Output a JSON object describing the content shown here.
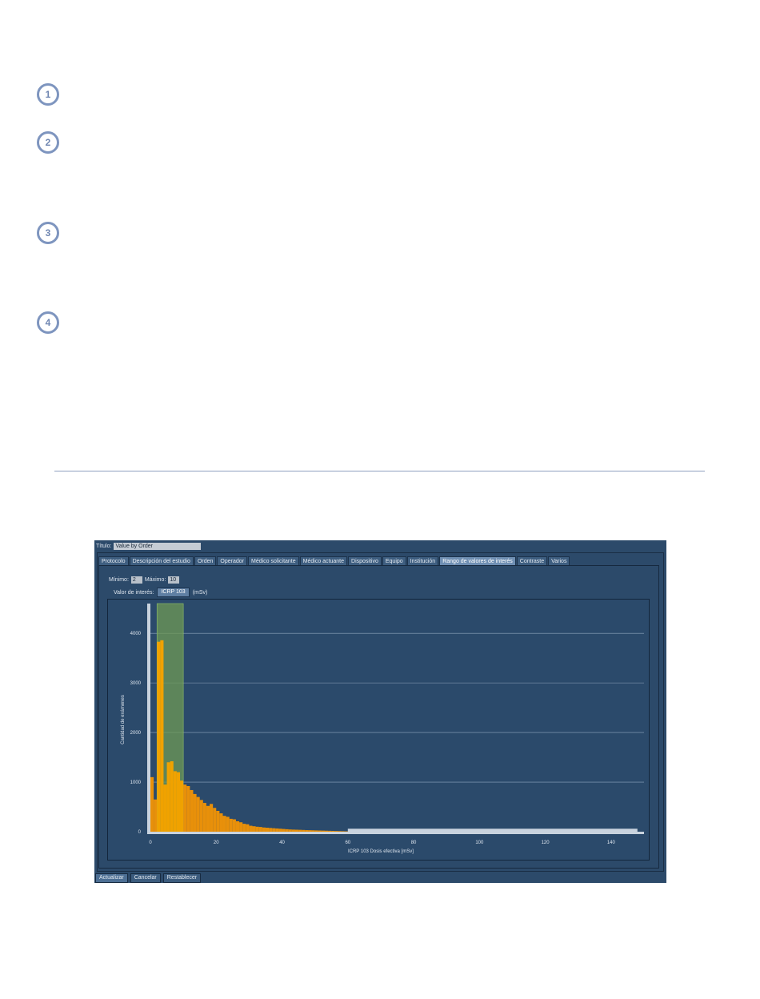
{
  "steps": [
    "1",
    "2",
    "3",
    "4"
  ],
  "app": {
    "title_label": "Título:",
    "title_value": "Value by Order",
    "tabs": [
      {
        "label": "Protocolo"
      },
      {
        "label": "Descripción del estudio"
      },
      {
        "label": "Orden"
      },
      {
        "label": "Operador"
      },
      {
        "label": "Médico solicitante"
      },
      {
        "label": "Médico actuante"
      },
      {
        "label": "Dispositivo"
      },
      {
        "label": "Equipo"
      },
      {
        "label": "Institución"
      },
      {
        "label": "Rango de valores de interés",
        "active": true
      },
      {
        "label": "Contraste"
      },
      {
        "label": "Varios"
      }
    ],
    "min_label": "Mínimo:",
    "min_value": "2",
    "max_label": "Máximo:",
    "max_value": "10",
    "value_label": "Valor de interés:",
    "value_button": "ICRP 103",
    "unit": "(mSv)",
    "buttons": {
      "update": "Actualizar",
      "cancel": "Cancelar",
      "reset": "Restablecer"
    }
  },
  "chart_data": {
    "type": "bar",
    "xlabel": "ICRP 103 Dosis efectiva [mSv]",
    "ylabel": "Cantidad de exámenes",
    "xlim": [
      0,
      150
    ],
    "ylim": [
      0,
      4600
    ],
    "xticks": [
      0,
      20,
      40,
      60,
      80,
      100,
      120,
      140
    ],
    "yticks": [
      0,
      1000,
      2000,
      3000,
      4000
    ],
    "bin_width": 1,
    "highlight_range": [
      2,
      10
    ],
    "x": [
      0,
      1,
      2,
      3,
      4,
      5,
      6,
      7,
      8,
      9,
      10,
      11,
      12,
      13,
      14,
      15,
      16,
      17,
      18,
      19,
      20,
      21,
      22,
      23,
      24,
      25,
      26,
      27,
      28,
      29,
      30,
      31,
      32,
      33,
      34,
      35,
      36,
      37,
      38,
      39,
      40,
      41,
      42,
      43,
      44,
      45,
      46,
      47,
      48,
      49,
      50,
      51,
      52,
      53,
      54,
      55,
      56,
      57,
      58,
      59,
      60
    ],
    "values": [
      1100,
      650,
      3830,
      3860,
      950,
      1400,
      1420,
      1220,
      1200,
      1030,
      950,
      920,
      840,
      760,
      700,
      640,
      580,
      520,
      560,
      480,
      420,
      370,
      320,
      300,
      260,
      250,
      210,
      190,
      160,
      150,
      120,
      110,
      100,
      95,
      85,
      80,
      75,
      70,
      65,
      60,
      55,
      50,
      45,
      42,
      40,
      38,
      35,
      32,
      30,
      28,
      26,
      24,
      22,
      20,
      18,
      16,
      14,
      12,
      10,
      8,
      6
    ],
    "colors": {
      "bar": "#f0a200",
      "bar_outside": "#e8900a",
      "highlight": "#6f9a54",
      "grid": "#8fa6bd"
    }
  }
}
